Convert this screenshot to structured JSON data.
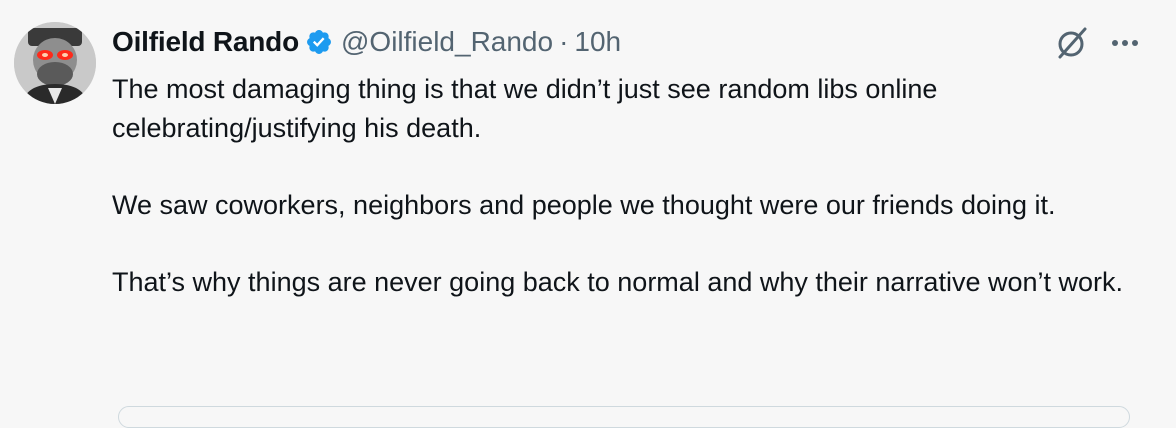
{
  "author": {
    "name": "Oilfield Rando",
    "handle": "@Oilfield_Rando",
    "separator": "·",
    "time": "10h",
    "verified": true,
    "badge_color": "#1d9bf0"
  },
  "icons": {
    "grok": "grok-icon",
    "more": "more-icon",
    "verified": "verified-badge-icon"
  },
  "body": {
    "paragraph_1": "The most damaging thing is that we didn’t just see random libs online celebrating/justifying his death.",
    "paragraph_2": "We saw coworkers, neighbors and people we thought were our friends doing it.",
    "paragraph_3": "That’s why things are never going back to normal and why their narrative won’t work."
  }
}
